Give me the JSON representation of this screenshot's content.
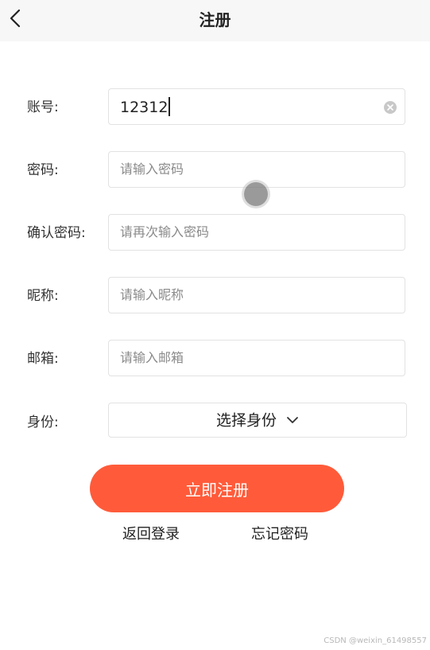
{
  "header": {
    "title": "注册",
    "back_icon": "chevron-left-icon"
  },
  "form": {
    "account": {
      "label": "账号:",
      "value": "12312",
      "clear_icon": "clear-circle-icon"
    },
    "password": {
      "label": "密码:",
      "placeholder": "请输入密码"
    },
    "confirm_password": {
      "label": "确认密码:",
      "placeholder": "请再次输入密码"
    },
    "nickname": {
      "label": "昵称:",
      "placeholder": "请输入昵称"
    },
    "email": {
      "label": "邮箱:",
      "placeholder": "请输入邮箱"
    },
    "identity": {
      "label": "身份:",
      "selected": "选择身份",
      "dropdown_icon": "chevron-down-icon"
    }
  },
  "actions": {
    "submit_label": "立即注册",
    "back_login_label": "返回登录",
    "forgot_password_label": "忘记密码"
  },
  "watermark": "CSDN @weixin_61498557",
  "colors": {
    "header_bg": "#f7f7f7",
    "primary": "#ff5b3a",
    "border": "#e2e2e2",
    "placeholder": "#8a8a8a"
  }
}
